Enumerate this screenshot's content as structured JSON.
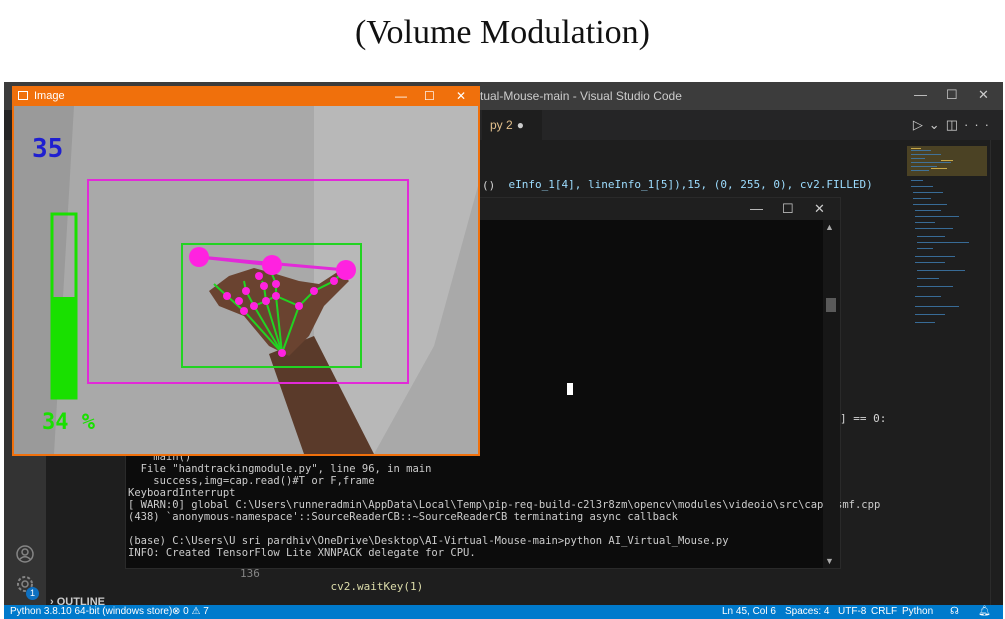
{
  "caption": "(Volume Modulation)",
  "vscode": {
    "window_title": "rtual-Mouse-main - Visual Studio Code",
    "tab_label": "py 2",
    "tab_modified_dot": "●",
    "code_line_1": "eInfo_1[4], lineInfo_1[5]),15, (0, 255, 0), cv2.FILLED)",
    "code_line_2": "()",
    "code_line_3": "] == 0:",
    "bottom_line_number": "136",
    "bottom_code": "cv2.waitKey(1)",
    "outline_label": "OUTLINE",
    "gear_badge": "1",
    "status": {
      "python": "Python 3.8.10 64-bit (windows store)",
      "problems": "⊗ 0 ⚠ 7",
      "position": "Ln 45, Col 6",
      "spaces": "Spaces: 4",
      "encoding": "UTF-8",
      "eol": "CRLF",
      "language": "Python"
    }
  },
  "terminal": {
    "lines": [
      "    main()",
      "  File \"handtrackingmodule.py\", line 96, in main",
      "    success,img=cap.read()#T or F,frame",
      "KeyboardInterrupt",
      "[ WARN:0] global C:\\Users\\runneradmin\\AppData\\Local\\Temp\\pip-req-build-c2l3r8zm\\opencv\\modules\\videoio\\src\\cap_msmf.cpp",
      "(438) `anonymous-namespace'::SourceReaderCB::~SourceReaderCB terminating async callback",
      "",
      "(base) C:\\Users\\U sri pardhiv\\OneDrive\\Desktop\\AI-Virtual-Mouse-main>python AI_Virtual_Mouse.py",
      "INFO: Created TensorFlow Lite XNNPACK delegate for CPU."
    ]
  },
  "image_window": {
    "title": "Image",
    "volume_value": "35",
    "volume_percent_label": "34 %",
    "volume_fraction": 0.34,
    "colors": {
      "purple_box": "#e22ad8",
      "green_box": "#22d322",
      "landmark": "#ff22e0",
      "volume_bar": "#19e000"
    }
  }
}
